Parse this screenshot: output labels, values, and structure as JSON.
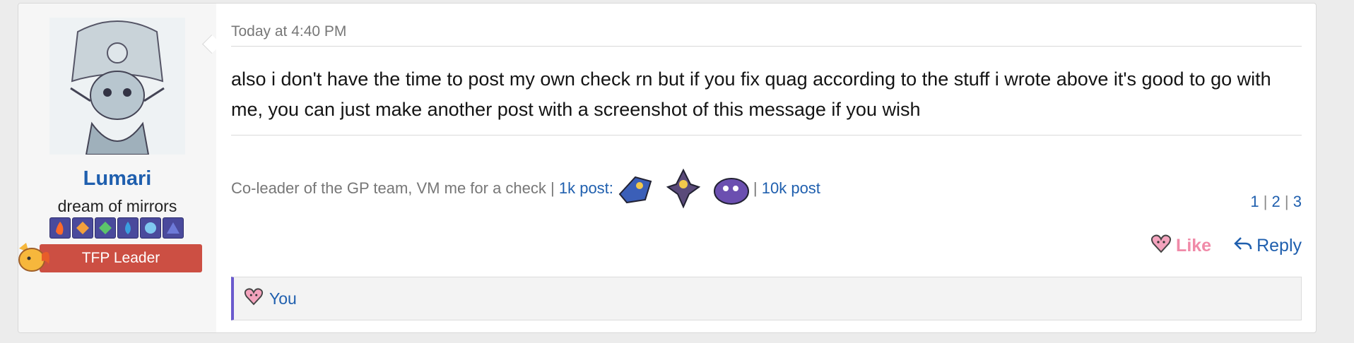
{
  "user": {
    "name": "Lumari",
    "title": "dream of mirrors",
    "banner": "TFP Leader",
    "badges": [
      "fire-badge",
      "diamond-badge",
      "leaf-badge",
      "water-badge",
      "ice-badge",
      "triangle-badge"
    ]
  },
  "post": {
    "date": "Today at 4:40 PM",
    "message": "also i don't have the time to post my own check rn but if you fix quag according to the stuff i wrote above it's good to go with me, you can just make another post with a screenshot of this message if you wish"
  },
  "signature": {
    "text": "Co-leader of the GP team, VM me for a check |",
    "link_1k": "1k post:",
    "separator": "|",
    "link_10k": "10k post",
    "pages": [
      "1",
      "2",
      "3"
    ],
    "page_sep": "|"
  },
  "actions": {
    "like": "Like",
    "reply": "Reply"
  },
  "reactions": {
    "label": "You"
  },
  "colors": {
    "link": "#1f5fae",
    "like": "#f08aa8",
    "banner": "#cc4f43",
    "reaction_bar": "#6a5acd"
  }
}
